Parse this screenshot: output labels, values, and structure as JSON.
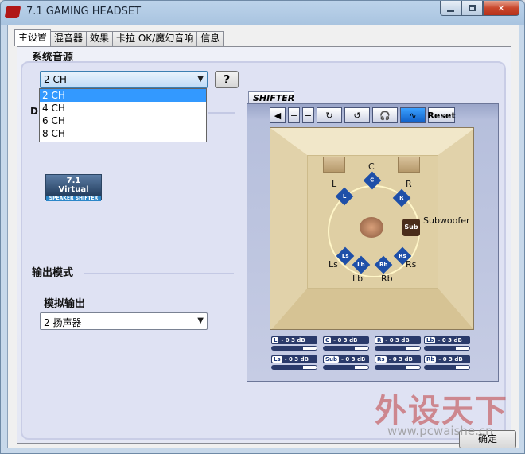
{
  "window": {
    "title": "7.1 GAMING HEADSET",
    "minimize_icon": "minimize-icon",
    "maximize_icon": "maximize-icon",
    "close_glyph": "✕"
  },
  "tabs": [
    {
      "label": "主设置",
      "active": true
    },
    {
      "label": "混音器"
    },
    {
      "label": "效果"
    },
    {
      "label": "卡拉 OK/魔幻音响"
    },
    {
      "label": "信息"
    }
  ],
  "source": {
    "heading": "系统音源",
    "selected": "2 CH",
    "help_label": "?",
    "options": [
      "2 CH",
      "4 CH",
      "6 CH",
      "8 CH"
    ],
    "hidden_label_fragment": "D"
  },
  "virtual_logo": {
    "line1": "7.1",
    "line2": "Virtual",
    "line3": "SPEAKER SHIFTER"
  },
  "output": {
    "heading": "输出模式",
    "sublabel": "模拟输出",
    "selected": "2 扬声器"
  },
  "shifter": {
    "tab_label": "SHIFTER",
    "toolbar": [
      "speaker-mute-icon",
      "plus-icon",
      "minus-icon",
      "rotate-cw-icon",
      "rotate-ccw-icon",
      "headphone-icon",
      "wave-icon"
    ],
    "reset_label": "Reset",
    "speakers": {
      "C": "C",
      "L": "L",
      "R": "R",
      "Ls": "Ls",
      "Rs": "Rs",
      "Lb": "Lb",
      "Rb": "Rb",
      "Sub": "Sub",
      "sub_name": "Subwoofer"
    },
    "channels": [
      {
        "tag": "L",
        "value": "- 0 3 dB"
      },
      {
        "tag": "C",
        "value": "- 0 3 dB"
      },
      {
        "tag": "R",
        "value": "- 0 3 dB"
      },
      {
        "tag": "Lb",
        "value": "- 0 3 dB"
      },
      {
        "tag": "Ls",
        "value": "- 0 3 dB"
      },
      {
        "tag": "Sub",
        "value": "- 0 3 dB"
      },
      {
        "tag": "Rs",
        "value": "- 0 3 dB"
      },
      {
        "tag": "Rb",
        "value": "- 0 3 dB"
      }
    ]
  },
  "ok_label": "确定",
  "watermark": {
    "text": "外设天下",
    "url": "www.pcwaishe.cn"
  }
}
